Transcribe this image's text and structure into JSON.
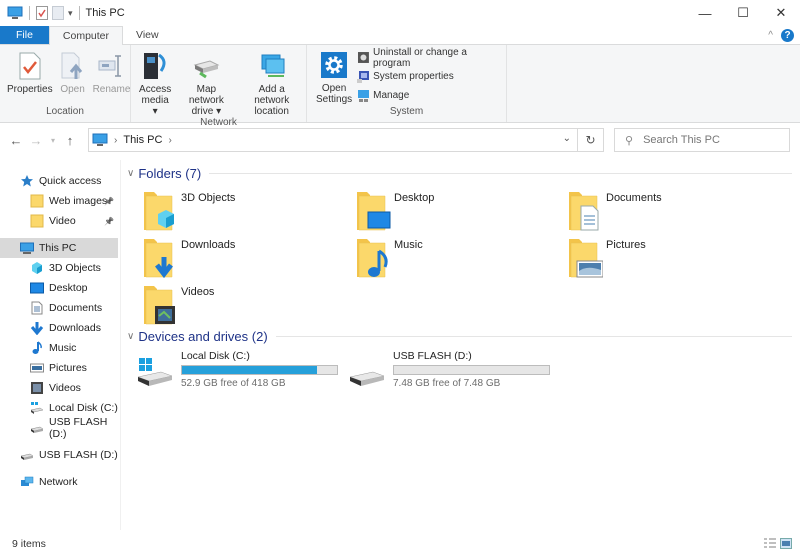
{
  "window": {
    "title": "This PC",
    "controls": {
      "minimize": "—",
      "maximize": "☐",
      "close": "✕"
    }
  },
  "ribbon_tabs": [
    {
      "label": "File"
    },
    {
      "label": "Computer",
      "active": true
    },
    {
      "label": "View"
    }
  ],
  "ribbon": {
    "groups": [
      {
        "label": "Location",
        "buttons": [
          {
            "label": "Properties",
            "icon": "properties-icon",
            "enabled": true
          },
          {
            "label": "Open",
            "icon": "open-icon",
            "enabled": false
          },
          {
            "label": "Rename",
            "icon": "rename-icon",
            "enabled": false
          }
        ]
      },
      {
        "label": "Network",
        "buttons": [
          {
            "label": "Access",
            "label2": "media ▾",
            "icon": "access-media-icon"
          },
          {
            "label": "Map network",
            "label2": "drive ▾",
            "icon": "map-network-drive-icon"
          },
          {
            "label": "Add a network",
            "label2": "location",
            "icon": "add-network-location-icon"
          }
        ]
      },
      {
        "label": "System",
        "big_button": {
          "label": "Open",
          "label2": "Settings",
          "icon": "settings-gear-icon"
        },
        "small_buttons": [
          {
            "label": "Uninstall or change a program",
            "icon": "uninstall-icon"
          },
          {
            "label": "System properties",
            "icon": "system-properties-icon"
          },
          {
            "label": "Manage",
            "icon": "manage-icon"
          }
        ]
      }
    ],
    "collapse_glyph": "^",
    "help_glyph": "?"
  },
  "address_bar": {
    "path": [
      "This PC"
    ],
    "search_placeholder": "Search This PC"
  },
  "sidebar": {
    "items": [
      {
        "label": "Quick access",
        "icon": "star-icon"
      },
      {
        "label": "Web images",
        "icon": "folder-icon",
        "pinned": true
      },
      {
        "label": "Video",
        "icon": "folder-icon",
        "pinned": true
      },
      {
        "label": "This PC",
        "icon": "computer-icon",
        "selected": true
      },
      {
        "label": "3D Objects",
        "icon": "cube-icon"
      },
      {
        "label": "Desktop",
        "icon": "desktop-icon"
      },
      {
        "label": "Documents",
        "icon": "document-icon"
      },
      {
        "label": "Downloads",
        "icon": "download-arrow-icon"
      },
      {
        "label": "Music",
        "icon": "music-note-icon"
      },
      {
        "label": "Pictures",
        "icon": "picture-icon"
      },
      {
        "label": "Videos",
        "icon": "film-icon"
      },
      {
        "label": "Local Disk (C:)",
        "icon": "local-disk-icon"
      },
      {
        "label": "USB FLASH (D:)",
        "icon": "usb-drive-icon"
      },
      {
        "label": "USB FLASH (D:)",
        "icon": "usb-drive-icon"
      },
      {
        "label": "Network",
        "icon": "network-icon"
      }
    ]
  },
  "main": {
    "folders_header": "Folders (7)",
    "folders": [
      {
        "label": "3D Objects",
        "icon": "3d-objects-folder-icon"
      },
      {
        "label": "Desktop",
        "icon": "desktop-folder-icon"
      },
      {
        "label": "Documents",
        "icon": "documents-folder-icon"
      },
      {
        "label": "Downloads",
        "icon": "downloads-folder-icon"
      },
      {
        "label": "Music",
        "icon": "music-folder-icon"
      },
      {
        "label": "Pictures",
        "icon": "pictures-folder-icon"
      },
      {
        "label": "Videos",
        "icon": "videos-folder-icon"
      }
    ],
    "drives_header": "Devices and drives (2)",
    "drives": [
      {
        "label": "Local Disk (C:)",
        "free_text": "52.9 GB free of 418 GB",
        "used_fraction": 0.873,
        "icon": "windows-drive-icon"
      },
      {
        "label": "USB FLASH (D:)",
        "free_text": "7.48 GB free of 7.48 GB",
        "used_fraction": 0.0,
        "icon": "usb-drive-icon"
      }
    ]
  },
  "status_bar": {
    "item_count": "9 items"
  },
  "colors": {
    "accent": "#1979ca",
    "drive_bar": "#26a0da",
    "section_header": "#1e3287",
    "selection": "#d9d9d9"
  }
}
